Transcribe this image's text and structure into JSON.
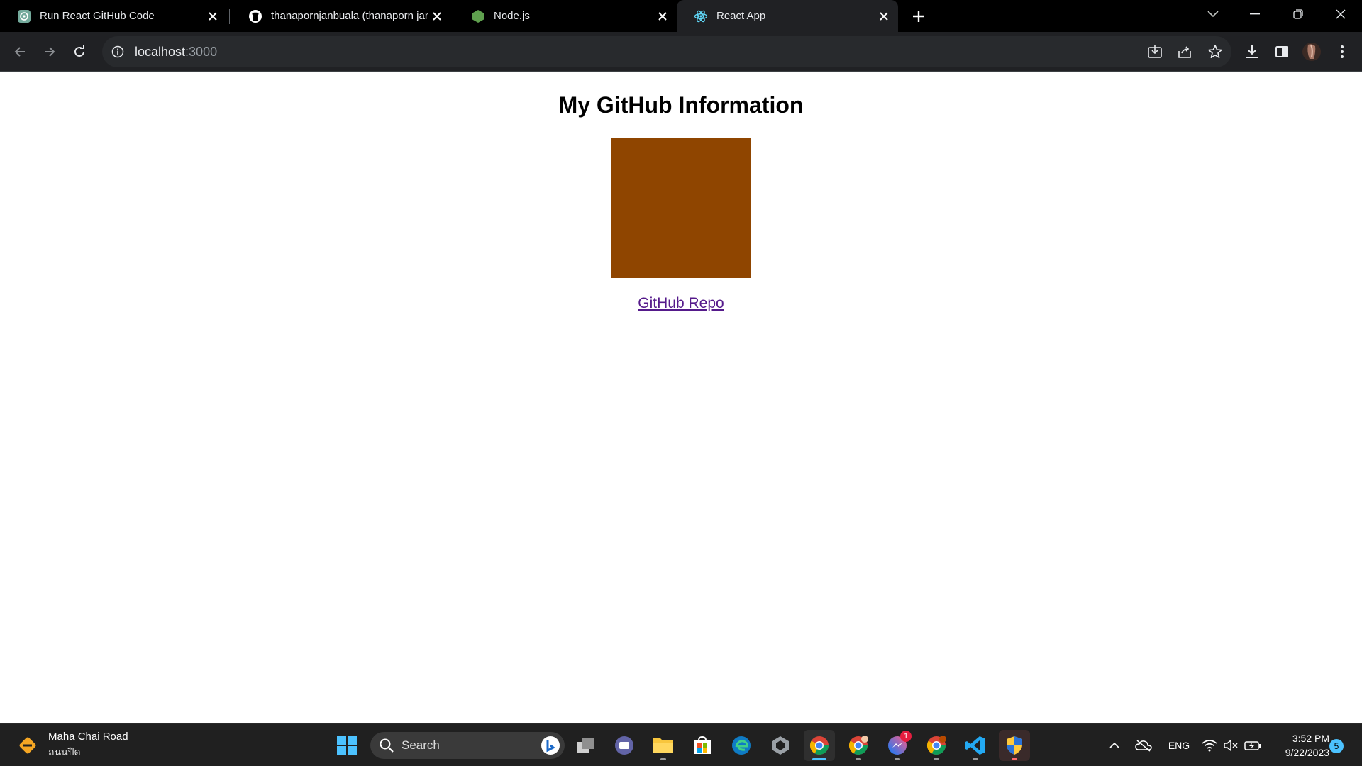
{
  "browser": {
    "tabs": [
      {
        "title": "Run React GitHub Code",
        "icon": "chatgpt-icon",
        "active": false
      },
      {
        "title": "thanapornjanbuala (thanaporn janbuala)",
        "icon": "github-icon",
        "active": false
      },
      {
        "title": "Node.js",
        "icon": "nodejs-icon",
        "active": false
      },
      {
        "title": "React App",
        "icon": "react-icon",
        "active": true
      }
    ],
    "address": {
      "host": "localhost",
      "port": ":3000"
    }
  },
  "page": {
    "heading": "My GitHub Information",
    "avatar_color": "#8f4500",
    "repo_link": "GitHub Repo"
  },
  "taskbar": {
    "weather": {
      "line1": "Maha Chai Road",
      "line2": "ถนนปิด"
    },
    "search_label": "Search",
    "apps": [
      "start",
      "search",
      "bing",
      "task-view",
      "teams",
      "file-explorer",
      "store",
      "edge",
      "unity",
      "chrome",
      "chrome-profile-2",
      "messenger",
      "chrome-profile-3",
      "vscode",
      "security"
    ],
    "messenger_badge": "1",
    "language": "ENG",
    "time": "3:52 PM",
    "date": "9/22/2023",
    "notification_count": "5"
  }
}
